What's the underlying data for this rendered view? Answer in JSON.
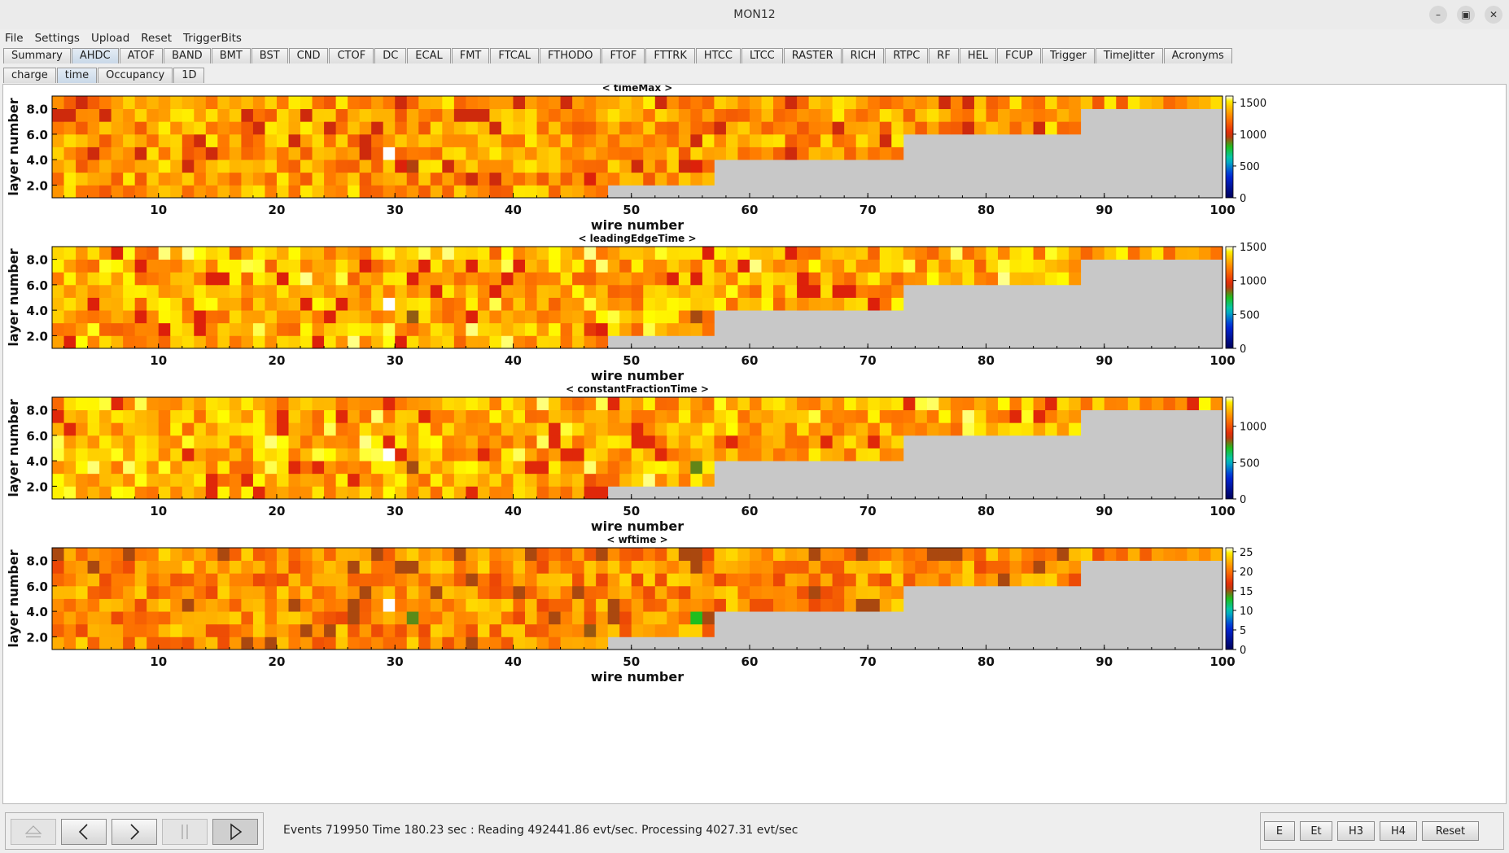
{
  "window": {
    "title": "MON12"
  },
  "menu": [
    "File",
    "Settings",
    "Upload",
    "Reset",
    "TriggerBits"
  ],
  "detector_tabs": [
    "Summary",
    "AHDC",
    "ATOF",
    "BAND",
    "BMT",
    "BST",
    "CND",
    "CTOF",
    "DC",
    "ECAL",
    "FMT",
    "FTCAL",
    "FTHODO",
    "FTOF",
    "FTTRK",
    "HTCC",
    "LTCC",
    "RASTER",
    "RICH",
    "RTPC",
    "RF",
    "HEL",
    "FCUP",
    "Trigger",
    "TimeJitter",
    "Acronyms"
  ],
  "active_detector_tab": "AHDC",
  "sub_tabs": [
    "charge",
    "time",
    "Occupancy",
    "1D"
  ],
  "active_sub_tab": "time",
  "colors": {
    "empty_bin": "#c8c8c8",
    "panel_bg": "#eeeeee",
    "active_tab": "#c9d8e8"
  },
  "chart_data": [
    {
      "type": "heatmap",
      "title": "< timeMax >",
      "xlabel": "wire number",
      "ylabel": "layer number",
      "xlim": [
        1,
        100
      ],
      "ylim": [
        1,
        9
      ],
      "x_ticks": [
        "10",
        "20",
        "30",
        "40",
        "50",
        "60",
        "70",
        "80",
        "90",
        "100"
      ],
      "y_ticks": [
        "2.0",
        "4.0",
        "6.0",
        "8.0"
      ],
      "z_ticks": [
        "0",
        "500",
        "1000",
        "1500"
      ],
      "zlim": [
        0,
        1600
      ],
      "occupied_wires_per_layer": [
        47,
        56,
        56,
        72,
        72,
        87,
        87,
        99
      ],
      "typical_range": [
        1150,
        1520
      ],
      "notable_bins": [
        {
          "wire": 29,
          "layer": 4,
          "value": 1600
        },
        {
          "wire": 30,
          "layer": 3,
          "value": 1000
        },
        {
          "wire": 31,
          "layer": 3,
          "value": 950
        },
        {
          "wire": 46,
          "layer": 2,
          "value": 1000
        },
        {
          "wire": 55,
          "layer": 3,
          "value": 1000
        }
      ]
    },
    {
      "type": "heatmap",
      "title": "< leadingEdgeTime >",
      "xlabel": "wire number",
      "ylabel": "layer number",
      "xlim": [
        1,
        100
      ],
      "ylim": [
        1,
        9
      ],
      "x_ticks": [
        "10",
        "20",
        "30",
        "40",
        "50",
        "60",
        "70",
        "80",
        "90",
        "100"
      ],
      "y_ticks": [
        "2.0",
        "4.0",
        "6.0",
        "8.0"
      ],
      "z_ticks": [
        "0",
        "500",
        "1000",
        "1500"
      ],
      "zlim": [
        0,
        1500
      ],
      "occupied_wires_per_layer": [
        47,
        56,
        56,
        72,
        72,
        87,
        87,
        99
      ],
      "typical_range": [
        1100,
        1480
      ],
      "notable_bins": [
        {
          "wire": 29,
          "layer": 4,
          "value": 1500
        },
        {
          "wire": 31,
          "layer": 3,
          "value": 860
        },
        {
          "wire": 55,
          "layer": 3,
          "value": 880
        },
        {
          "wire": 46,
          "layer": 2,
          "value": 1000
        }
      ]
    },
    {
      "type": "heatmap",
      "title": "< constantFractionTime >",
      "xlabel": "wire number",
      "ylabel": "layer number",
      "xlim": [
        1,
        100
      ],
      "ylim": [
        1,
        9
      ],
      "x_ticks": [
        "10",
        "20",
        "30",
        "40",
        "50",
        "60",
        "70",
        "80",
        "90",
        "100"
      ],
      "y_ticks": [
        "2.0",
        "4.0",
        "6.0",
        "8.0"
      ],
      "z_ticks": [
        "0",
        "500",
        "1000"
      ],
      "zlim": [
        0,
        1400
      ],
      "occupied_wires_per_layer": [
        47,
        56,
        56,
        72,
        72,
        87,
        87,
        99
      ],
      "typical_range": [
        1050,
        1380
      ],
      "notable_bins": [
        {
          "wire": 29,
          "layer": 4,
          "value": 1400
        },
        {
          "wire": 31,
          "layer": 3,
          "value": 820
        },
        {
          "wire": 55,
          "layer": 3,
          "value": 760
        },
        {
          "wire": 46,
          "layer": 2,
          "value": 990
        }
      ]
    },
    {
      "type": "heatmap",
      "title": "< wftime >",
      "xlabel": "wire number",
      "ylabel": "layer number",
      "xlim": [
        1,
        100
      ],
      "ylim": [
        1,
        9
      ],
      "x_ticks": [
        "10",
        "20",
        "30",
        "40",
        "50",
        "60",
        "70",
        "80",
        "90",
        "100"
      ],
      "y_ticks": [
        "2.0",
        "4.0",
        "6.0",
        "8.0"
      ],
      "z_ticks": [
        "0",
        "5",
        "10",
        "15",
        "20",
        "25"
      ],
      "zlim": [
        0,
        26
      ],
      "occupied_wires_per_layer": [
        47,
        56,
        56,
        72,
        72,
        87,
        87,
        99
      ],
      "typical_range": [
        18,
        24
      ],
      "notable_bins": [
        {
          "wire": 29,
          "layer": 4,
          "value": 26
        },
        {
          "wire": 31,
          "layer": 3,
          "value": 14
        },
        {
          "wire": 55,
          "layer": 3,
          "value": 13
        },
        {
          "wire": 46,
          "layer": 2,
          "value": 15
        }
      ]
    }
  ],
  "control_buttons": [
    "eject",
    "prev",
    "next",
    "pause",
    "play"
  ],
  "status": "Events 719950  Time 180.23 sec : Reading 492441.86  evt/sec. Processing 4027.31 evt/sec",
  "right_buttons": [
    "E",
    "Et",
    "H3",
    "H4",
    "Reset"
  ]
}
